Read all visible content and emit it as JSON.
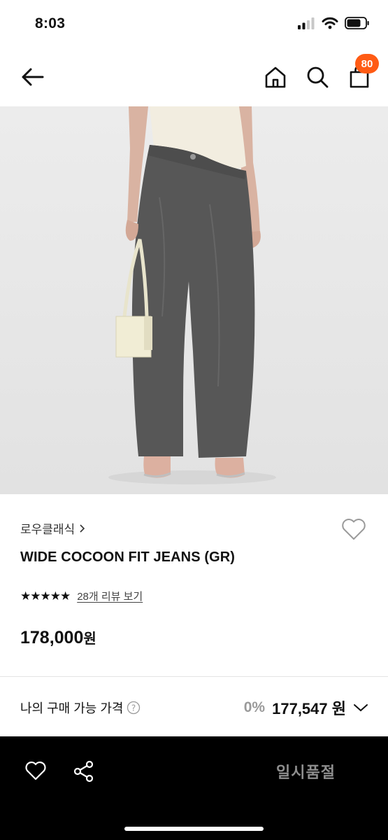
{
  "status_bar": {
    "time": "8:03"
  },
  "nav": {
    "cart_count": "80"
  },
  "product": {
    "brand": "로우클래식",
    "name": "WIDE COCOON FIT JEANS (GR)",
    "stars": "★★★★★",
    "review_link": "28개 리뷰 보기",
    "price": "178,000",
    "price_unit": "원"
  },
  "my_price": {
    "label": "나의 구매 가능 가격",
    "discount": "0%",
    "amount": "177,547 원"
  },
  "bottom_bar": {
    "soldout_label": "일시품절"
  },
  "colors": {
    "accent": "#ff5b14",
    "bottom_bar_bg": "#000000",
    "muted": "#8e8e8e"
  },
  "icons": [
    "back-arrow-icon",
    "home-icon",
    "search-icon",
    "cart-icon",
    "heart-icon",
    "share-icon",
    "help-icon",
    "chevron-down-icon",
    "chevron-right-icon"
  ]
}
